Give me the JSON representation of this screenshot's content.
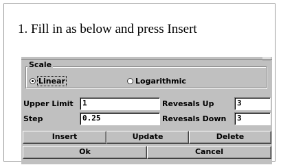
{
  "instruction": "1. Fill in as below and press Insert",
  "scale": {
    "title": "Scale",
    "options": [
      {
        "label": "Linear",
        "selected": true
      },
      {
        "label": "Logarithmic",
        "selected": false
      }
    ]
  },
  "fields": {
    "upper_limit": {
      "label": "Upper Limit",
      "value": "1"
    },
    "step": {
      "label": "Step",
      "value": "0.25"
    },
    "reversals_up": {
      "label": "Revesals Up",
      "value": "3"
    },
    "reversals_down": {
      "label": "Revesals Down",
      "value": "3"
    }
  },
  "buttons": {
    "insert": "Insert",
    "update": "Update",
    "delete": "Delete",
    "ok": "Ok",
    "cancel": "Cancel"
  },
  "colors": {
    "dialog_face": "#c0c0c0",
    "field_bg": "#ffffff"
  }
}
